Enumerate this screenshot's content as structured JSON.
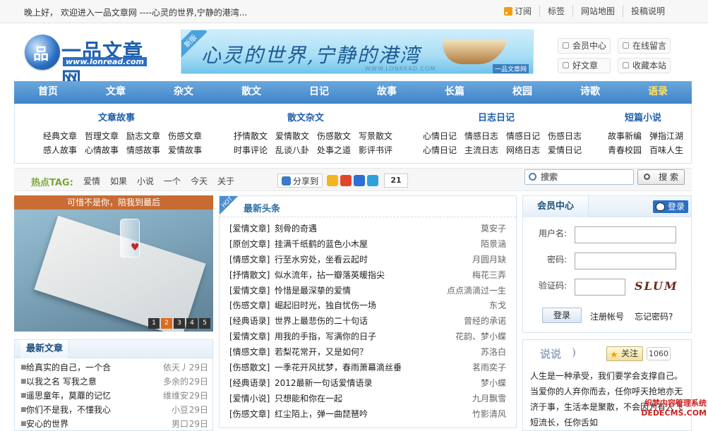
{
  "topbar": {
    "greeting": "晚上好， 欢迎进入一品文章网 ----心灵的世界,宁静的港湾...",
    "links": [
      "订阅",
      "标签",
      "网站地图",
      "投稿说明"
    ]
  },
  "logo": {
    "name": "一品文章网",
    "url": "www.lonread.com"
  },
  "banner": {
    "tag": "新版",
    "text": "心灵的世界,宁静的港湾",
    "sub": "WWW.LONREAD.COM",
    "brand": "一品文章网"
  },
  "quick": [
    "会员中心",
    "在线留言",
    "好文章",
    "收藏本站"
  ],
  "nav": [
    "首页",
    "文章",
    "杂文",
    "散文",
    "日记",
    "故事",
    "长篇",
    "校园",
    "诗歌",
    "语录"
  ],
  "subnav": [
    {
      "title": "文章故事",
      "row1": [
        "经典文章",
        "哲理文章",
        "励志文章",
        "伤感文章"
      ],
      "row2": [
        "感人故事",
        "心情故事",
        "情感故事",
        "爱情故事"
      ]
    },
    {
      "title": "散文杂文",
      "row1": [
        "抒情散文",
        "爱情散文",
        "伤感散文",
        "写景散文"
      ],
      "row2": [
        "时事评论",
        "乱谈八卦",
        "处事之道",
        "影评书评"
      ]
    },
    {
      "title": "日志日记",
      "row1": [
        "心情日记",
        "情感日志",
        "情感日记",
        "伤感日志"
      ],
      "row2": [
        "心情日记",
        "主流日志",
        "网络日志",
        "爱情日记"
      ]
    },
    {
      "title": "短篇小说",
      "row1": [
        "故事新编",
        "弹指江湖"
      ],
      "row2": [
        "青春校园",
        "百味人生"
      ]
    }
  ],
  "hotbar": {
    "label": "热点TAG:",
    "tags": [
      "爱情",
      "如果",
      "小说",
      "一个",
      "今天",
      "关于"
    ],
    "share_label": "分享到",
    "share_count": "21"
  },
  "search": {
    "placeholder": "搜索",
    "button": "搜 索"
  },
  "slide": {
    "caption": "可惜不是你，陪我到最后",
    "pages": [
      "1",
      "2",
      "3",
      "4",
      "5"
    ],
    "active": 2
  },
  "latest": {
    "title": "最新文章",
    "items": [
      {
        "title": "给真实的自己，一个合",
        "author": "依天丿",
        "date": "29日"
      },
      {
        "title": "以我之名 写我之意",
        "author": "多余的",
        "date": "29日"
      },
      {
        "title": "遥思童年，莫蘼的记忆",
        "author": "维维安",
        "date": "29日"
      },
      {
        "title": "你们不是我，不懂我心",
        "author": "小豆",
        "date": "29日"
      },
      {
        "title": "安心的世界",
        "author": "男口",
        "date": "29日"
      }
    ]
  },
  "headline": {
    "title": "最新头条",
    "hot": "HOT",
    "items": [
      {
        "cat": "[爱情文章]",
        "title": "刻骨的奇遇",
        "author": "莫安子"
      },
      {
        "cat": "[原创文章]",
        "title": "挂满千纸鹤的蓝色小木屋",
        "author": "陌景涵"
      },
      {
        "cat": "[情感文章]",
        "title": "行至水穷处，坐看云起时",
        "author": "月圆月缺"
      },
      {
        "cat": "[抒情散文]",
        "title": "似水流年，拈一瓣落英暖指尖",
        "author": "梅花三弄"
      },
      {
        "cat": "[爱情文章]",
        "title": "怜惜是最深挚的爱情",
        "author": "点点滴滴过一生"
      },
      {
        "cat": "[伤感文章]",
        "title": "崛起旧时光，独自忧伤一场",
        "author": "东戈"
      },
      {
        "cat": "[经典语录]",
        "title": "世界上最悲伤的二十句话",
        "author": "曾经的承诺"
      },
      {
        "cat": "[爱情文章]",
        "title": "用我的手指，写满你的日子",
        "author": "花韵、梦小蝶"
      },
      {
        "cat": "[情感文章]",
        "title": "若梨花常开，又是如何？",
        "author": "苏洛白"
      },
      {
        "cat": "[伤感散文]",
        "title": "一季花开风扰梦，春雨萧幕滴丝垂",
        "author": "茗雨奕子"
      },
      {
        "cat": "[经典语录]",
        "title": "2012最新一句话爱情语录",
        "author": "梦小蝶"
      },
      {
        "cat": "[爱情小说]",
        "title": "只想能和你在一起",
        "author": "九月飘雪"
      },
      {
        "cat": "[伤感文章]",
        "title": "红尘陌上，弹一曲琵琶吟",
        "author": "竹影清风"
      }
    ]
  },
  "member": {
    "title": "会员中心",
    "qq": "登录",
    "user_label": "用户名:",
    "pass_label": "密码:",
    "code_label": "验证码:",
    "captcha": "SLUM",
    "login": "登录",
    "register": "注册帐号",
    "forgot": "忘记密码?"
  },
  "talk": {
    "title": "说说",
    "follow": "关注",
    "count": "1060",
    "body": "人生是一种承受，我们要学会支撑自己。当爱你的人弃你而去，任你呼天抢地亦无济于事，生活本是聚散，不会因为有人飞短流长，任你舌如"
  },
  "watermark": {
    "line1": "织梦内容管理系统",
    "line2": "DEDECMS.COM"
  }
}
